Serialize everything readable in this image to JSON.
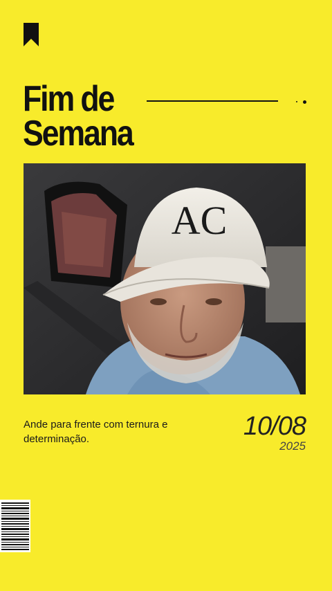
{
  "title": {
    "line1": "Fim de",
    "line2": "Semana"
  },
  "photo": {
    "cap_text": "AC"
  },
  "quote": "Ande para frente com ternura e determinação.",
  "date": {
    "day_month": "10/08",
    "year": "2025"
  },
  "colors": {
    "background": "#F8EB2B",
    "text": "#111111"
  },
  "icons": [
    "bookmark-icon",
    "barcode-icon"
  ]
}
